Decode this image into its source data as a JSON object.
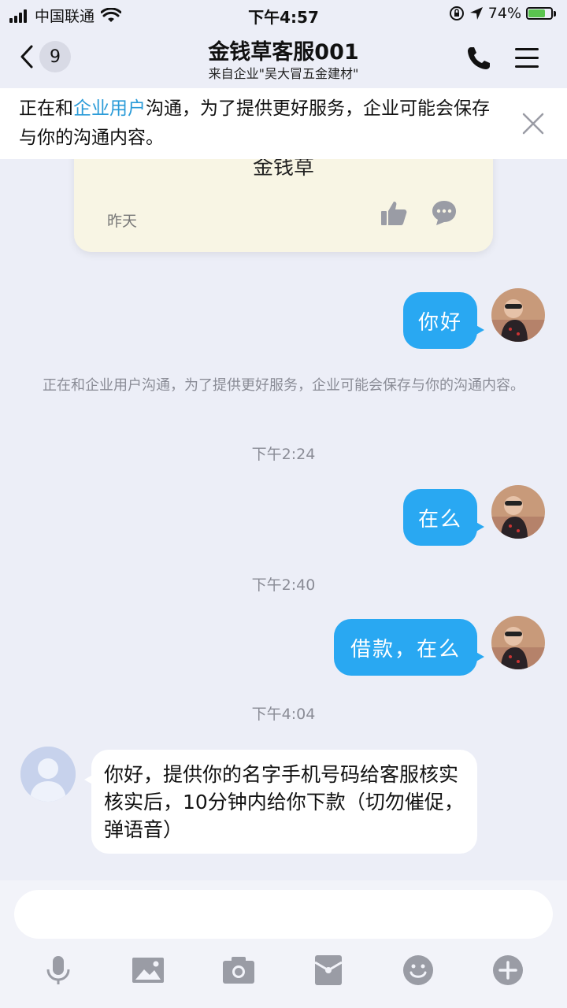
{
  "status_bar": {
    "carrier": "中国联通",
    "time": "下午4:57",
    "battery": "74%",
    "battery_level": 0.74
  },
  "header": {
    "unread_count": "9",
    "title": "金钱草客服001",
    "subtitle": "来自企业\"吴大冒五金建材\""
  },
  "notice": {
    "text_before": "正在和",
    "link": "企业用户",
    "text_after": "沟通，为了提供更好服务，企业可能会保存与你的沟通内容。"
  },
  "messages": {
    "card": {
      "text": "金钱草",
      "date": "昨天"
    },
    "msg1": "你好",
    "system_note": "正在和企业用户沟通，为了提供更好服务，企业可能会保存与你的沟通内容。",
    "time1": "下午2:24",
    "msg2": "在么",
    "time2": "下午2:40",
    "msg3": "借款，在么",
    "time3": "下午4:04",
    "reply": "你好，提供你的名字手机号码给客服核实核实后，10分钟内给你下款（切勿催促，弹语音）"
  },
  "input": {
    "placeholder": ""
  },
  "icons": {
    "back": "chevron-left-icon",
    "call": "phone-icon",
    "menu": "menu-icon",
    "close": "close-icon",
    "like": "thumbs-up-icon",
    "comment": "comment-icon",
    "voice": "microphone-icon",
    "image": "image-icon",
    "camera": "camera-icon",
    "red_packet": "red-packet-icon",
    "emoji": "emoji-icon",
    "plus": "plus-icon"
  },
  "colors": {
    "accent": "#29a8f2",
    "link": "#2a9bd8",
    "background": "#eceef7",
    "card": "#f8f5e4"
  }
}
